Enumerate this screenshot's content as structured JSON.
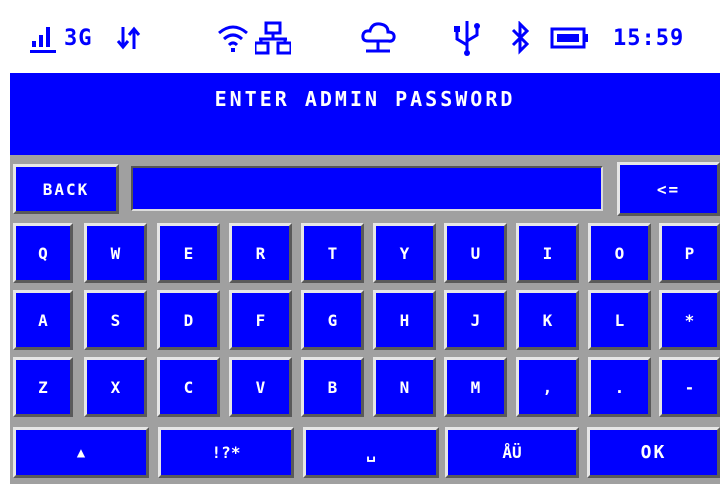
{
  "status_bar": {
    "network": "3G",
    "time": "15:59",
    "icons": [
      "signal-bars-icon",
      "data-arrows-icon",
      "wifi-icon",
      "network-icon",
      "cloud-icon",
      "usb-icon",
      "bluetooth-icon",
      "battery-icon"
    ]
  },
  "title": "ENTER ADMIN PASSWORD",
  "top_row": {
    "back_label": "BACK",
    "password_value": "",
    "backspace_label": "<="
  },
  "keys": {
    "row1": [
      "Q",
      "W",
      "E",
      "R",
      "T",
      "Y",
      "U",
      "I",
      "O",
      "P"
    ],
    "row2": [
      "A",
      "S",
      "D",
      "F",
      "G",
      "H",
      "J",
      "K",
      "L",
      "*"
    ],
    "row3": [
      "Z",
      "X",
      "C",
      "V",
      "B",
      "N",
      "M",
      ",",
      ".",
      "-"
    ]
  },
  "bottom_row": {
    "shift_label": "▲",
    "symbols_label": "!?*",
    "space_label": "␣",
    "lang_label": "ÅÜ",
    "ok_label": "OK"
  },
  "colors": {
    "key_blue": "#0000ff",
    "panel_grey": "#a0a0a0",
    "text": "#ffffff"
  }
}
